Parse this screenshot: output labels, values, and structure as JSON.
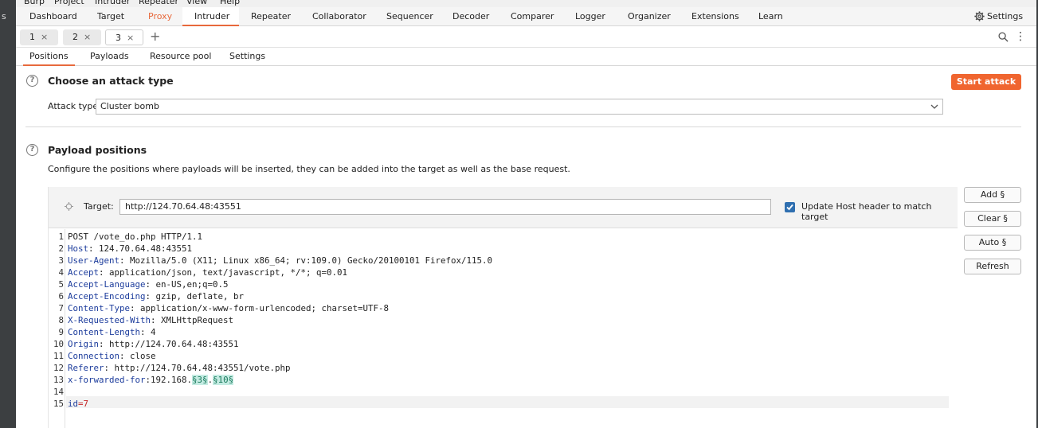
{
  "menu": [
    "Burp",
    "Project",
    "Intruder",
    "Repeater",
    "View",
    "Help"
  ],
  "top_tabs": [
    "Dashboard",
    "Target",
    "Proxy",
    "Intruder",
    "Repeater",
    "Collaborator",
    "Sequencer",
    "Decoder",
    "Comparer",
    "Logger",
    "Organizer",
    "Extensions",
    "Learn"
  ],
  "settings_label": "Settings",
  "sub_tabs": [
    {
      "label": "1",
      "close": "×"
    },
    {
      "label": "2",
      "close": "×"
    },
    {
      "label": "3",
      "close": "×"
    }
  ],
  "add_tab": "+",
  "config_tabs": [
    "Positions",
    "Payloads",
    "Resource pool",
    "Settings"
  ],
  "attack": {
    "title": "Choose an attack type",
    "start_label": "Start attack",
    "type_label": "Attack type:",
    "type_value": "Cluster bomb"
  },
  "positions": {
    "title": "Payload positions",
    "description": "Configure the positions where payloads will be inserted, they can be added into the target as well as the base request.",
    "target_label": "Target:",
    "target_value": "http://124.70.64.48:43551",
    "update_host_label": "Update Host header to match target",
    "update_host_checked": true
  },
  "buttons": {
    "add": "Add §",
    "clear": "Clear §",
    "auto": "Auto §",
    "refresh": "Refresh"
  },
  "request": {
    "line1": "POST /vote_do.php HTTP/1.1",
    "headers": [
      {
        "n": "2",
        "k": "Host",
        "v": "124.70.64.48:43551"
      },
      {
        "n": "3",
        "k": "User-Agent",
        "v": "Mozilla/5.0 (X11; Linux x86_64; rv:109.0) Gecko/20100101 Firefox/115.0"
      },
      {
        "n": "4",
        "k": "Accept",
        "v": "application/json, text/javascript, */*; q=0.01"
      },
      {
        "n": "5",
        "k": "Accept-Language",
        "v": "en-US,en;q=0.5"
      },
      {
        "n": "6",
        "k": "Accept-Encoding",
        "v": "gzip, deflate, br"
      },
      {
        "n": "7",
        "k": "Content-Type",
        "v": "application/x-www-form-urlencoded; charset=UTF-8"
      },
      {
        "n": "8",
        "k": "X-Requested-With",
        "v": "XMLHttpRequest"
      },
      {
        "n": "9",
        "k": "Content-Length",
        "v": "4"
      },
      {
        "n": "10",
        "k": "Origin",
        "v": "http://124.70.64.48:43551"
      },
      {
        "n": "11",
        "k": "Connection",
        "v": "close"
      },
      {
        "n": "12",
        "k": "Referer",
        "v": "http://124.70.64.48:43551/vote.php"
      }
    ],
    "xff_key": "x-forwarded-for",
    "xff_prefix": "192.168.",
    "xff_payload1": "§3§",
    "xff_sep": ".",
    "xff_payload2": "§10§",
    "body_key": "id",
    "body_eq": "=",
    "body_val": "7",
    "line_numbers": [
      "1",
      "13",
      "14",
      "15"
    ]
  }
}
